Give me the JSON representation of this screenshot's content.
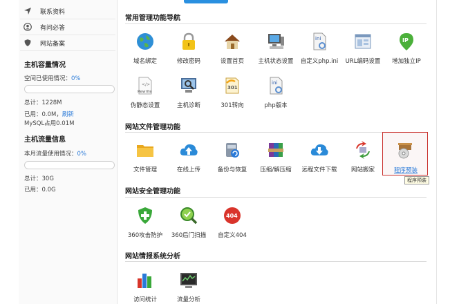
{
  "sidebar": {
    "nav_items": [
      {
        "label": "联系资料",
        "icon": "send-icon"
      },
      {
        "label": "有问必答",
        "icon": "user-icon"
      },
      {
        "label": "网站备案",
        "icon": "shield-icon"
      }
    ],
    "capacity": {
      "title": "主机容量情况",
      "used_label": "空间已使用情况：",
      "used_percent": "0%",
      "progress": 0,
      "total": "总计：1228M",
      "used_prefix": "已用：0.0M，",
      "refresh_label": "刷新",
      "mysql": "MySQL占用0.01M"
    },
    "traffic": {
      "title": "主机流量信息",
      "used_label": "本月流量使用情况：",
      "used_percent": "0%",
      "progress": 0,
      "total": "总计：30G",
      "used": "已用：0.0G"
    }
  },
  "main": {
    "sections": [
      {
        "title": "常用管理功能导航",
        "tools": [
          {
            "label": "域名绑定",
            "icon": "globe-icon"
          },
          {
            "label": "修改密码",
            "icon": "lock-icon"
          },
          {
            "label": "设置首页",
            "icon": "home-icon"
          },
          {
            "label": "主机状态设置",
            "icon": "computer-icon"
          },
          {
            "label": "自定义php.ini",
            "icon": "ini-file-icon"
          },
          {
            "label": "URL编码设置",
            "icon": "window-icon"
          },
          {
            "label": "增加独立IP",
            "icon": "ip-pin-icon"
          },
          {
            "label": "伪静态设置",
            "icon": "rewrite-icon"
          },
          {
            "label": "主机诊断",
            "icon": "magnifier-monitor-icon"
          },
          {
            "label": "301转向",
            "icon": "redirect-301-icon"
          },
          {
            "label": "php版本",
            "icon": "php-file-icon"
          }
        ]
      },
      {
        "title": "网站文件管理功能",
        "tools": [
          {
            "label": "文件管理",
            "icon": "folder-icon"
          },
          {
            "label": "在线上传",
            "icon": "cloud-upload-icon"
          },
          {
            "label": "备份与恢复",
            "icon": "backup-icon"
          },
          {
            "label": "压缩/解压缩",
            "icon": "archive-icon"
          },
          {
            "label": "远程文件下载",
            "icon": "cloud-download-icon"
          },
          {
            "label": "网站搬家",
            "icon": "move-site-icon"
          },
          {
            "label": "程序预装",
            "icon": "install-disc-icon"
          }
        ],
        "tooltip": "程序预装"
      },
      {
        "title": "网站安全管理功能",
        "tools": [
          {
            "label": "360攻击防护",
            "icon": "shield-plus-icon"
          },
          {
            "label": "360后门扫描",
            "icon": "scan-icon"
          },
          {
            "label": "自定义404",
            "icon": "error-404-icon"
          }
        ]
      },
      {
        "title": "网站情报系统分析",
        "tools": [
          {
            "label": "访问统计",
            "icon": "bar-chart-icon"
          },
          {
            "label": "流量分析",
            "icon": "traffic-monitor-icon"
          }
        ]
      }
    ]
  },
  "colors": {
    "accent": "#2a7ad8",
    "selected_border": "#c9302c"
  }
}
